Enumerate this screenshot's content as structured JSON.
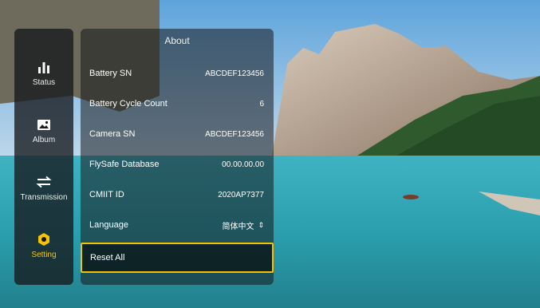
{
  "nav": {
    "items": [
      {
        "label": "Status",
        "icon": "bar-chart-icon",
        "active": false
      },
      {
        "label": "Album",
        "icon": "photo-icon",
        "active": false
      },
      {
        "label": "Transmission",
        "icon": "transfer-arrows-icon",
        "active": false
      },
      {
        "label": "Setting",
        "icon": "hexagon-gear-icon",
        "active": true
      }
    ]
  },
  "about": {
    "title": "About",
    "rows": [
      {
        "label": "Battery SN",
        "value": "ABCDEF123456"
      },
      {
        "label": "Battery Cycle Count",
        "value": "6"
      },
      {
        "label": "Camera SN",
        "value": "ABCDEF123456"
      },
      {
        "label": "FlySafe Database",
        "value": "00.00.00.00"
      },
      {
        "label": "CMIIT ID",
        "value": "2020AP7377"
      },
      {
        "label": "Language",
        "value": "简体中文",
        "icon": "up-down-arrows-icon"
      }
    ],
    "reset_label": "Reset All"
  },
  "colors": {
    "accent": "#f3c300",
    "panel_bg": "#16181c"
  }
}
